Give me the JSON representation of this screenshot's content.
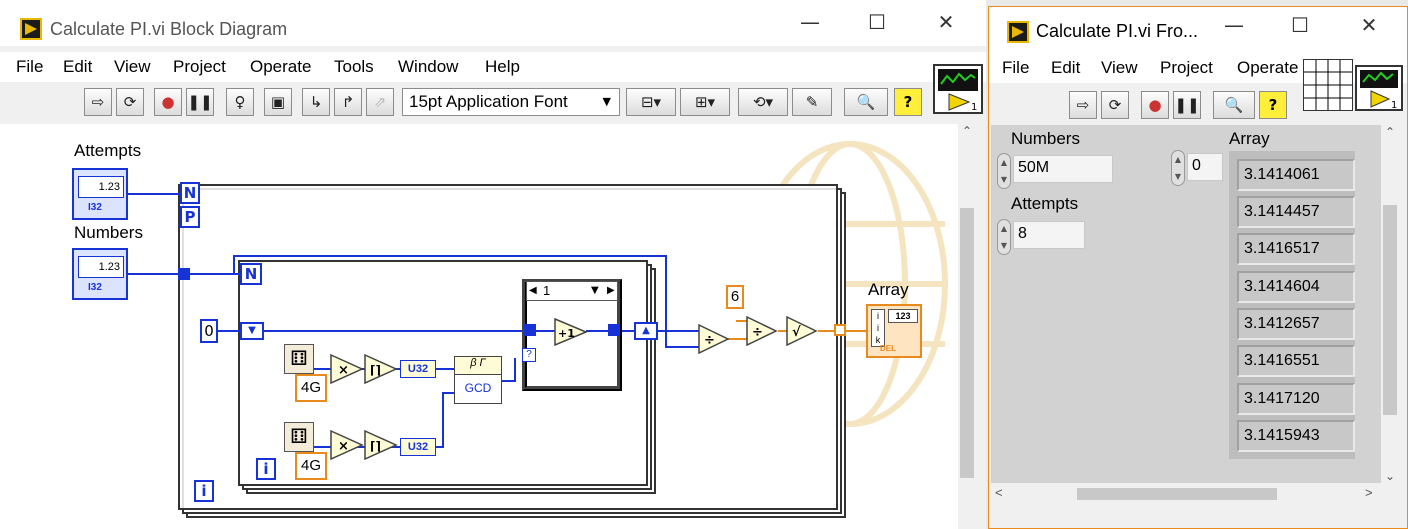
{
  "bd": {
    "title": "Calculate PI.vi Block Diagram",
    "menu": [
      "File",
      "Edit",
      "View",
      "Project",
      "Operate",
      "Tools",
      "Window",
      "Help"
    ],
    "font_label": "15pt Application Font",
    "labels": {
      "attempts": "Attempts",
      "numbers": "Numbers",
      "array": "Array"
    },
    "consts": {
      "n1": "N",
      "p": "P",
      "n2": "N",
      "zero": "0",
      "six": "6",
      "i1": "i",
      "i2": "i",
      "fourg1": "4G",
      "fourg2": "4G",
      "case": "1",
      "u32a": "U32",
      "u32b": "U32",
      "gcd": "GCD",
      "ctl": "1.23",
      "i32": "I32",
      "q": "?",
      "build": "123",
      "del": "DEL"
    }
  },
  "fp": {
    "title": "Calculate PI.vi Fro...",
    "menu": [
      "File",
      "Edit",
      "View",
      "Project",
      "Operate"
    ],
    "numbers_label": "Numbers",
    "numbers_value": "50M",
    "attempts_label": "Attempts",
    "attempts_value": "8",
    "array_label": "Array",
    "array_index": "0",
    "array_values": [
      "3.1414061",
      "3.1414457",
      "3.1416517",
      "3.1414604",
      "3.1412657",
      "3.1416551",
      "3.1417120",
      "3.1415943"
    ]
  }
}
